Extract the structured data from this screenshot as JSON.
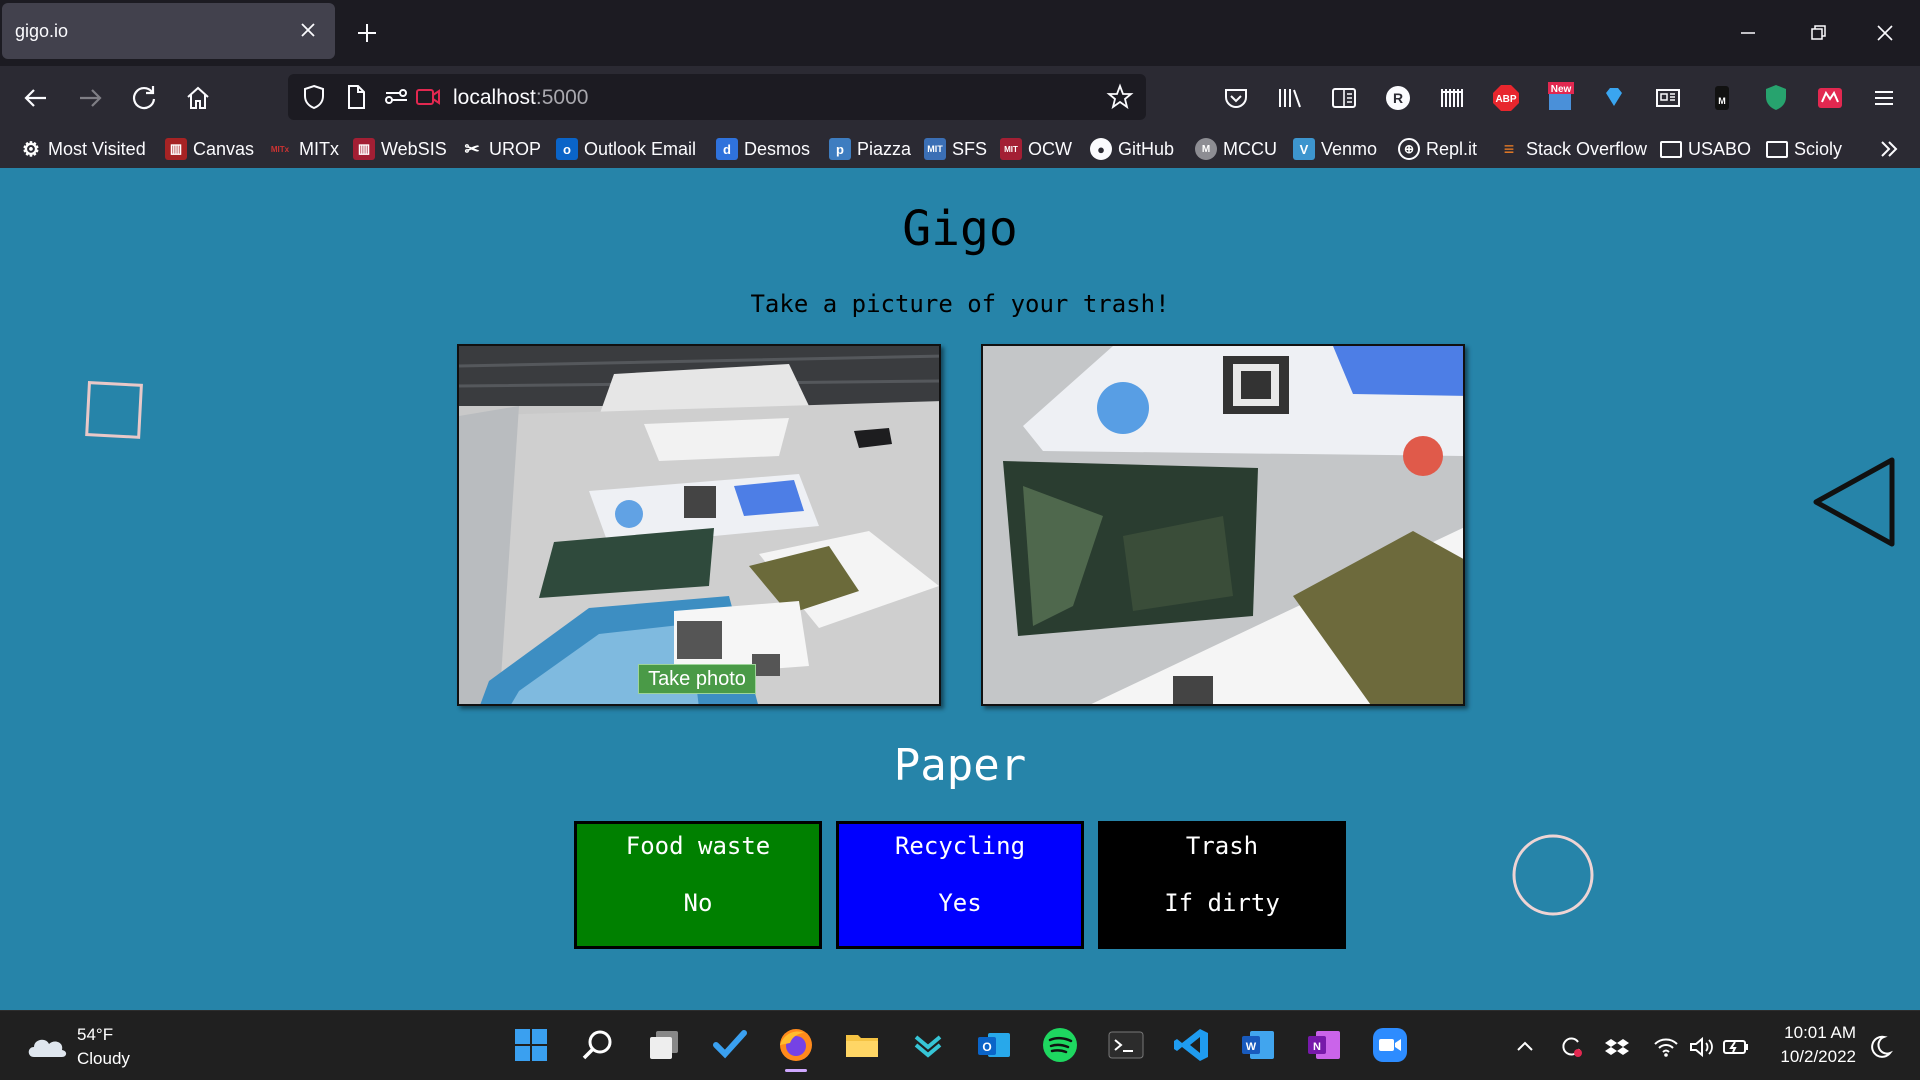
{
  "browser": {
    "tab_title": "gigo.io",
    "url_host": "localhost",
    "url_port": ":5000"
  },
  "bookmarks": [
    {
      "label": "Most Visited",
      "icon": "gear-icon"
    },
    {
      "label": "Canvas",
      "icon": "canvas-icon",
      "color": "#a62324"
    },
    {
      "label": "MITx",
      "icon": "mitx-icon",
      "color": "#8a0c1a"
    },
    {
      "label": "WebSIS",
      "icon": "mit-icon",
      "color": "#a31f34"
    },
    {
      "label": "UROP",
      "icon": "urop-icon"
    },
    {
      "label": "Outlook Email",
      "icon": "outlook-icon",
      "color": "#0a64c8"
    },
    {
      "label": "Desmos",
      "icon": "desmos-icon",
      "color": "#2f72dc"
    },
    {
      "label": "Piazza",
      "icon": "piazza-icon",
      "color": "#3e7dc0"
    },
    {
      "label": "SFS",
      "icon": "sfs-icon",
      "color": "#3b6fb5"
    },
    {
      "label": "OCW",
      "icon": "ocw-icon",
      "color": "#a31f34"
    },
    {
      "label": "GitHub",
      "icon": "github-icon"
    },
    {
      "label": "MCCU",
      "icon": "mccu-icon"
    },
    {
      "label": "Venmo",
      "icon": "venmo-icon",
      "color": "#3d95ce"
    },
    {
      "label": "Repl.it",
      "icon": "globe-icon"
    },
    {
      "label": "Stack Overflow",
      "icon": "stackoverflow-icon",
      "color": "#f48024"
    },
    {
      "label": "USABO",
      "icon": "folder-icon"
    },
    {
      "label": "Scioly",
      "icon": "folder-icon"
    }
  ],
  "page": {
    "title": "Gigo",
    "subtitle": "Take a picture of your trash!",
    "take_photo_label": "Take photo",
    "result_label": "Paper",
    "bins": [
      {
        "heading": "Food waste",
        "value": "No",
        "color": "#008000"
      },
      {
        "heading": "Recycling",
        "value": "Yes",
        "color": "#0000ff"
      },
      {
        "heading": "Trash",
        "value": "If dirty",
        "color": "#000000"
      }
    ]
  },
  "taskbar": {
    "weather_temp": "54°F",
    "weather_condition": "Cloudy",
    "time": "10:01 AM",
    "date": "10/2/2022"
  }
}
